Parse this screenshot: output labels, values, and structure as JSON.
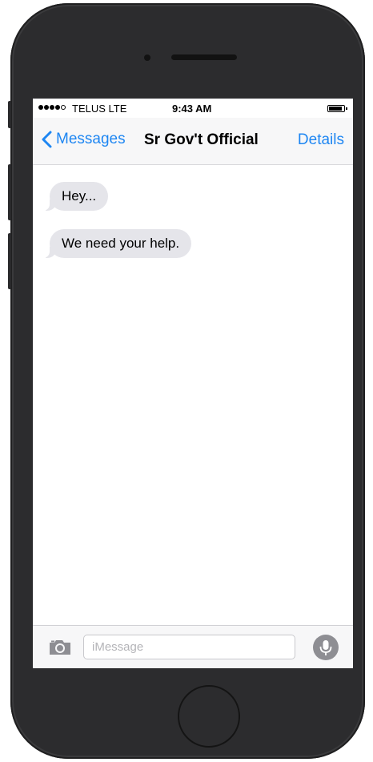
{
  "status_bar": {
    "carrier": "TELUS  LTE",
    "time": "9:43 AM",
    "signal_bars_filled": 4,
    "signal_bars_total": 5
  },
  "nav": {
    "back_label": "Messages",
    "title": "Sr Gov't Official",
    "details_label": "Details"
  },
  "messages": [
    {
      "text": "Hey..."
    },
    {
      "text": "We need your help."
    }
  ],
  "input": {
    "placeholder": "iMessage",
    "value": ""
  },
  "icons": {
    "back": "chevron-left-icon",
    "camera": "camera-icon",
    "mic": "microphone-icon",
    "battery": "battery-icon",
    "signal": "signal-dots-icon"
  },
  "colors": {
    "accent": "#1e86f2",
    "incoming_bubble": "#e5e5ea",
    "phone_body": "#2c2c2e",
    "bar_background": "#f7f7f8"
  }
}
